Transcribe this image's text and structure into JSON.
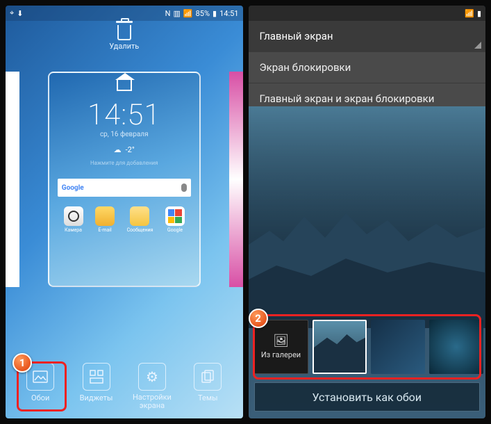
{
  "left": {
    "status": {
      "battery_pct": "85%",
      "time": "14:51"
    },
    "delete_label": "Удалить",
    "clock": {
      "time": "14:51",
      "date": "ср, 16 февраля"
    },
    "hint": "Нажмите для добавления",
    "search": {
      "logo": "Google"
    },
    "apps": [
      {
        "label": "Камера"
      },
      {
        "label": "E-mail"
      },
      {
        "label": "Сообщения"
      },
      {
        "label": "Google"
      }
    ],
    "actions": {
      "wallpaper": "Обои",
      "widgets": "Виджеты",
      "settings": "Настройки экрана",
      "themes": "Темы"
    },
    "badge": "1"
  },
  "right": {
    "options": {
      "home": "Главный экран",
      "lock": "Экран блокировки",
      "both": "Главный экран и экран блокировки"
    },
    "gallery_label": "Из галереи",
    "set_btn": "Установить как обои",
    "badge": "2"
  }
}
